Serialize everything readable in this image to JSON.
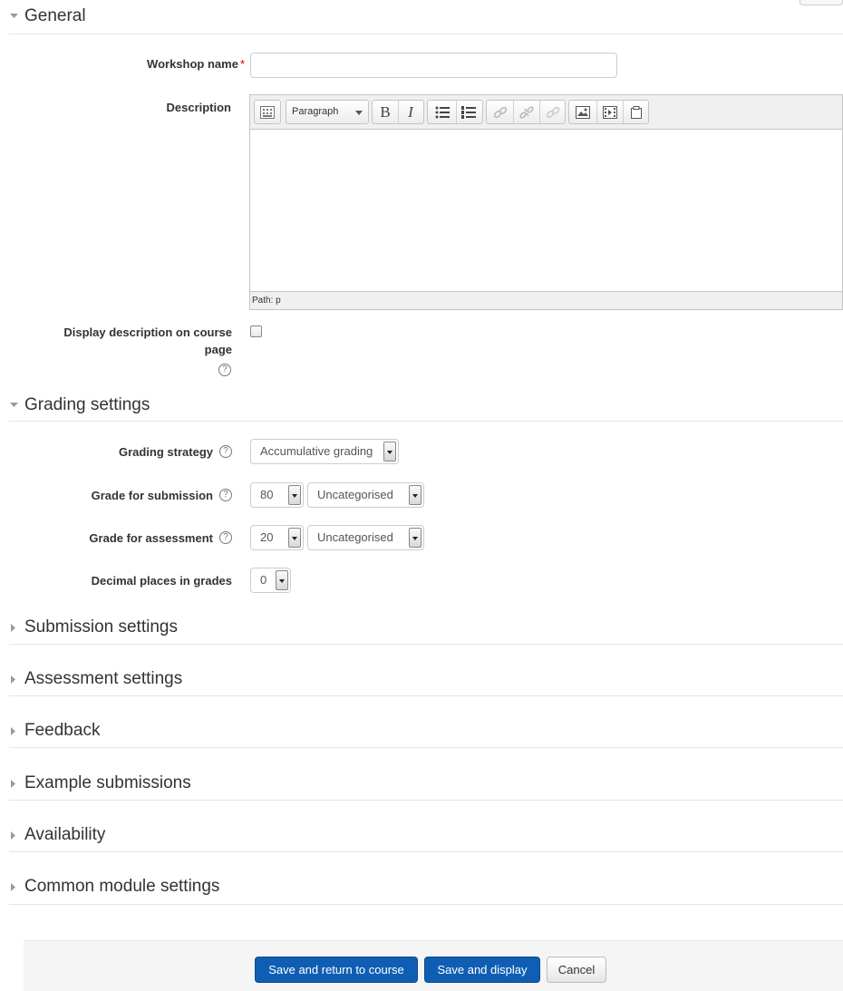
{
  "sections": {
    "general": "General",
    "grading": "Grading settings",
    "submission": "Submission settings",
    "assessment": "Assessment settings",
    "feedback": "Feedback",
    "examples": "Example submissions",
    "availability": "Availability",
    "common": "Common module settings"
  },
  "general": {
    "workshop_name_label": "Workshop name",
    "required_marker": "*",
    "workshop_name_value": "",
    "description_label": "Description",
    "editor": {
      "format_select": "Paragraph",
      "bold": "B",
      "italic": "I",
      "status_path": "Path: p"
    },
    "display_description_label_line1": "Display description on course",
    "display_description_label_line2": "page",
    "display_description_checked": false
  },
  "grading": {
    "strategy_label": "Grading strategy",
    "strategy_value": "Accumulative grading",
    "submission_label": "Grade for submission",
    "submission_grade": "80",
    "submission_category": "Uncategorised",
    "assessment_label": "Grade for assessment",
    "assessment_grade": "20",
    "assessment_category": "Uncategorised",
    "decimals_label": "Decimal places in grades",
    "decimals_value": "0"
  },
  "help_glyph": "?",
  "buttons": {
    "save_return": "Save and return to course",
    "save_display": "Save and display",
    "cancel": "Cancel"
  },
  "colors": {
    "primary_button": "#0f5eb4",
    "required": "#cc0000"
  }
}
